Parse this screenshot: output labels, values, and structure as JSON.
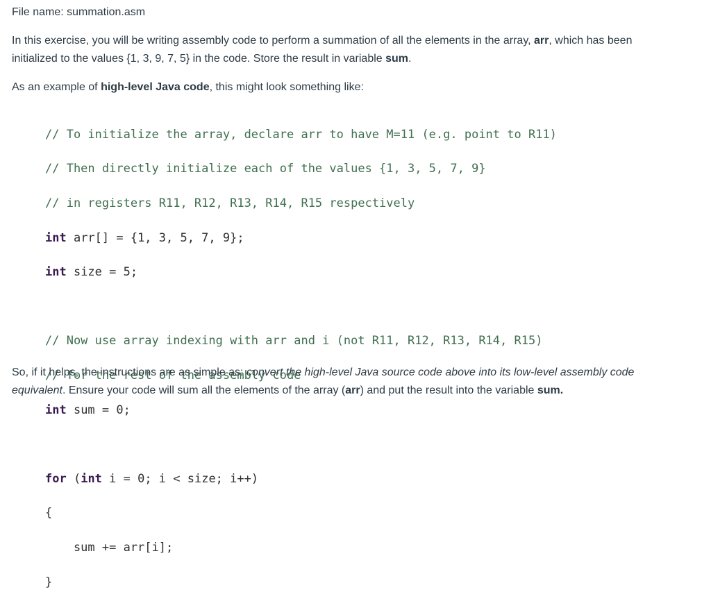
{
  "file_line": {
    "label": "File name:",
    "value": "summation.asm"
  },
  "intro": {
    "line1_a": "In this exercise, you will be writing assembly code to perform a summation of all the elements in the array, ",
    "line1_bold": "arr",
    "line1_b": ", which has been",
    "line2_a": "initialized to the values {1, 3, 9, 7, 5} in the code.  Store the result in variable ",
    "line2_bold": "sum",
    "line2_b": "."
  },
  "example": {
    "a": "As an example of ",
    "bold": "high-level Java code",
    "b": ", this might look something like:"
  },
  "code": {
    "c1": "// To initialize the array, declare arr to have M=11 (e.g. point to R11)",
    "c2": "// Then directly initialize each of the values {1, 3, 5, 7, 9}",
    "c3": "// in registers R11, R12, R13, R14, R15 respectively",
    "l4_kw": "int",
    "l4_rest": " arr[] = {1, 3, 5, 7, 9};",
    "l5_kw": "int",
    "l5_rest": " size = 5;",
    "c6": "// Now use array indexing with arr and i (not R11, R12, R13, R14, R15)",
    "c7": "// for the rest of the assembly code",
    "l8_kw": "int",
    "l8_rest": " sum = 0;",
    "l9_kw1": "for",
    "l9_mid": " (",
    "l9_kw2": "int",
    "l9_rest": " i = 0; i < size; i++)",
    "l10": "{",
    "l11": "    sum += arr[i];",
    "l12": "}"
  },
  "outro": {
    "line1_a": "So, if it helps, the instructions are as simple as: ",
    "line1_italic": "convert the high-level Java source code above into its low-level assembly code",
    "line2_italic": "equivalent",
    "line2_a": ".  Ensure your code will sum all the elements of the array (",
    "line2_bold1": "arr",
    "line2_b": ") and put the result into the variable ",
    "line2_bold2": "sum."
  }
}
